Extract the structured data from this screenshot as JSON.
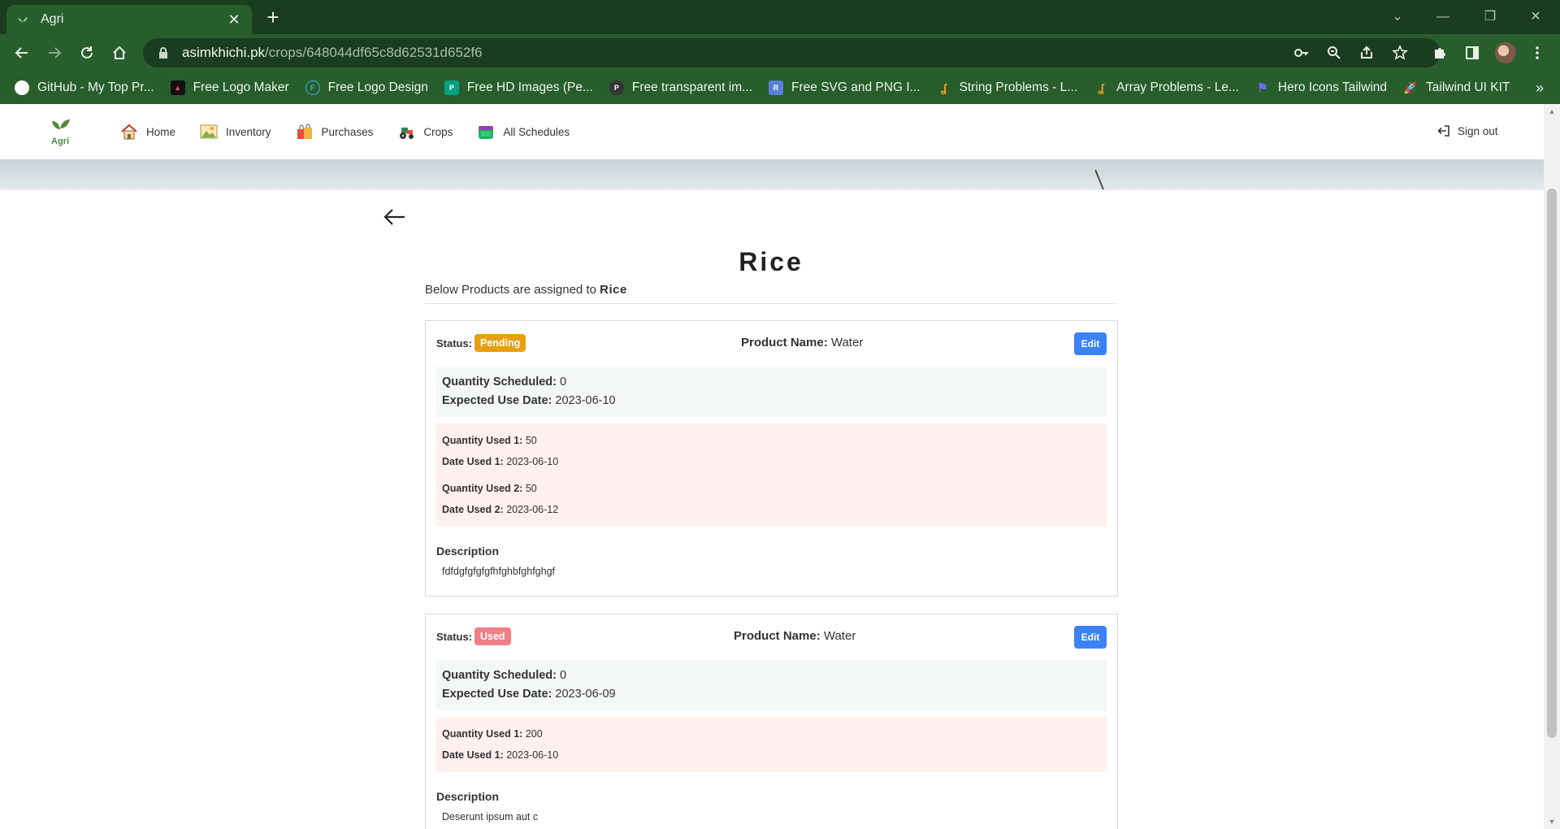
{
  "browser": {
    "tab_title": "Agri",
    "url_host": "asimkhichi.pk",
    "url_path": "/crops/648044df65c8d62531d652f6",
    "bookmarks": [
      {
        "label": "GitHub - My Top Pr...",
        "icon": "github-icon",
        "color": "#ffffff"
      },
      {
        "label": "Free Logo Maker",
        "icon": "logo-maker-icon",
        "color": "#ff4d6d"
      },
      {
        "label": "Free Logo Design",
        "icon": "flo-icon",
        "color": "#3bb3e0"
      },
      {
        "label": "Free HD Images (Pe...",
        "icon": "pexels-icon",
        "color": "#05a081"
      },
      {
        "label": "Free transparent im...",
        "icon": "png-icon",
        "color": "#333333"
      },
      {
        "label": "Free SVG and PNG I...",
        "icon": "svgrepo-icon",
        "color": "#5a7fd6"
      },
      {
        "label": "String Problems - L...",
        "icon": "leetcode-icon",
        "color": "#f0a020"
      },
      {
        "label": "Array Problems - Le...",
        "icon": "leetcode-icon",
        "color": "#f0a020"
      },
      {
        "label": "Hero Icons Tailwind",
        "icon": "flag-icon",
        "color": "#5b5bf0"
      },
      {
        "label": "Tailwind UI KIT",
        "icon": "rocket-icon",
        "color": "#f0f0f0"
      }
    ],
    "more": "»"
  },
  "nav": {
    "logo_text": "Agri",
    "links": [
      {
        "label": "Home",
        "icon": "house-icon"
      },
      {
        "label": "Inventory",
        "icon": "landscape-icon"
      },
      {
        "label": "Purchases",
        "icon": "shopping-bags-icon"
      },
      {
        "label": "Crops",
        "icon": "tractor-icon"
      },
      {
        "label": "All Schedules",
        "icon": "calendar-icon"
      }
    ],
    "signout": "Sign out"
  },
  "page": {
    "title": "Rice",
    "subtitle_prefix": "Below Products are assigned to",
    "subtitle_crop": "Rice"
  },
  "labels": {
    "status": "Status:",
    "product_name": "Product Name:",
    "edit": "Edit",
    "qty_scheduled": "Quantity Scheduled:",
    "expected_date": "Expected Use Date:",
    "description": "Description"
  },
  "cards": [
    {
      "status": "Pending",
      "product": "Water",
      "qty_scheduled": "0",
      "expected_date": "2023-06-10",
      "usages": [
        {
          "qty_label": "Quantity Used 1:",
          "qty": "50",
          "date_label": "Date Used 1:",
          "date": "2023-06-10"
        },
        {
          "qty_label": "Quantity Used 2:",
          "qty": "50",
          "date_label": "Date Used 2:",
          "date": "2023-06-12"
        }
      ],
      "description": "fdfdgfgfgfgfhfghbfghfghgf"
    },
    {
      "status": "Used",
      "product": "Water",
      "qty_scheduled": "0",
      "expected_date": "2023-06-09",
      "usages": [
        {
          "qty_label": "Quantity Used 1:",
          "qty": "200",
          "date_label": "Date Used 1:",
          "date": "2023-06-10"
        }
      ],
      "description": "Deserunt ipsum aut c"
    }
  ],
  "colors": {
    "pending": "#e8a010",
    "used": "#f07f86",
    "edit_button": "#3b82f6",
    "chrome": "#275e2c"
  }
}
